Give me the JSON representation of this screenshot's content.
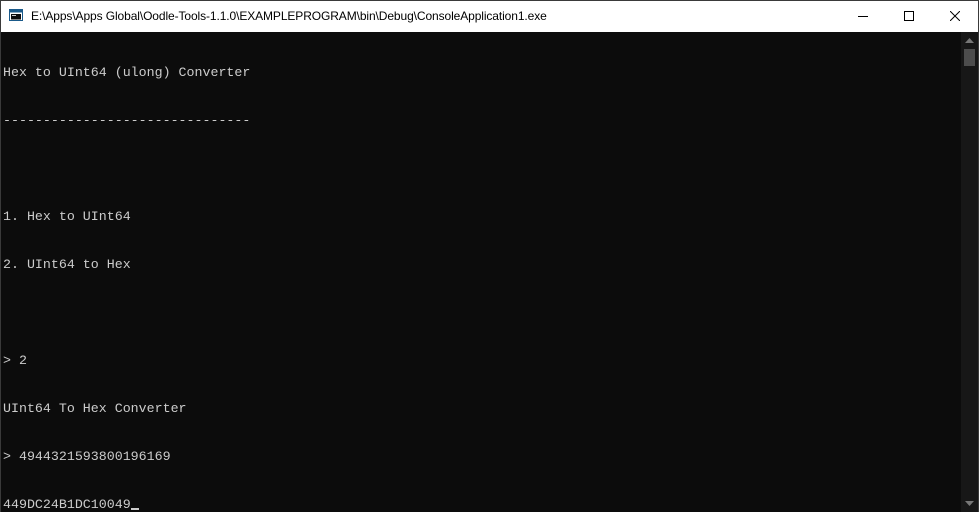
{
  "window": {
    "title": "E:\\Apps\\Apps Global\\Oodle-Tools-1.1.0\\EXAMPLEPROGRAM\\bin\\Debug\\ConsoleApplication1.exe"
  },
  "icons": {
    "app": "console-app-icon",
    "minimize": "minimize-icon",
    "maximize": "maximize-icon",
    "close": "close-icon"
  },
  "console": {
    "lines": [
      "Hex to UInt64 (ulong) Converter",
      "-------------------------------",
      "",
      "1. Hex to UInt64",
      "2. UInt64 to Hex",
      "",
      "> 2",
      "UInt64 To Hex Converter",
      "> 4944321593800196169",
      "449DC24B1DC10049"
    ]
  },
  "colors": {
    "background": "#0c0c0c",
    "foreground": "#cccccc",
    "titlebar": "#ffffff"
  }
}
